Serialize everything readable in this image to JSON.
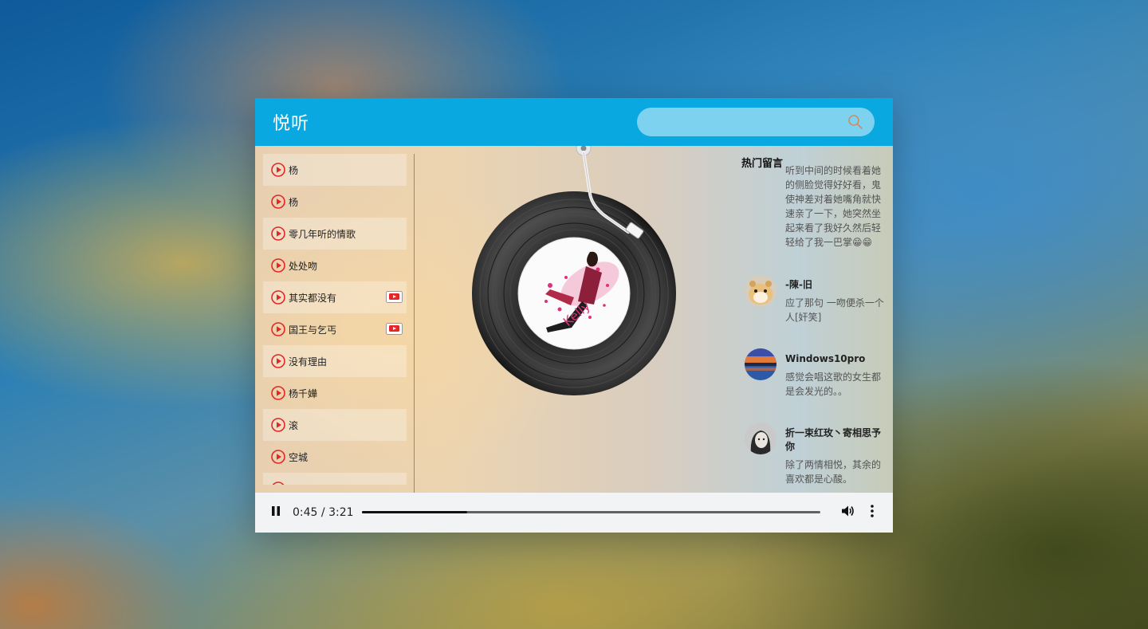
{
  "header": {
    "app_title": "悦听",
    "search": {
      "value": "",
      "placeholder": ""
    }
  },
  "playlist": [
    {
      "name": "杨",
      "has_mv": false
    },
    {
      "name": "杨",
      "has_mv": false
    },
    {
      "name": "零几年听的情歌",
      "has_mv": false
    },
    {
      "name": "处处吻",
      "has_mv": false
    },
    {
      "name": "其实都没有",
      "has_mv": true
    },
    {
      "name": "国王与乞丐",
      "has_mv": true
    },
    {
      "name": "没有理由",
      "has_mv": false
    },
    {
      "name": "杨千嬅",
      "has_mv": false
    },
    {
      "name": "滚",
      "has_mv": false
    },
    {
      "name": "空城",
      "has_mv": false
    },
    {
      "name": "",
      "has_mv": false
    }
  ],
  "comments": {
    "title": "热门留言",
    "items": [
      {
        "name": "",
        "text": "听到中间的时候看着她的侧脸觉得好好看，鬼使神差对着她嘴角就快速亲了一下，她突然坐起来看了我好久然后轻轻给了我一巴掌😁😁",
        "avatar_icon": ""
      },
      {
        "name": "-陳-旧",
        "text": "应了那句 一吻便杀一个人[奸笑]",
        "avatar_icon": "hamster-avatar"
      },
      {
        "name": "Windows10pro",
        "text": "感觉会唱这歌的女生都是会发光的。。",
        "avatar_icon": "sunset-lake-avatar"
      },
      {
        "name": "折一束红玫丶寄相思予你",
        "text": "除了两情相悦，其余的喜欢都是心酸。",
        "avatar_icon": "girl-portrait-avatar"
      }
    ]
  },
  "player": {
    "current_time": "0:45",
    "separator": "/",
    "duration": "3:21",
    "progress": 0.23
  },
  "colors": {
    "header_bg": "#0aa8e0",
    "search_bg": "#7dd3ef",
    "play_icon": "#e32626",
    "player_bg": "#f1f3f4"
  }
}
